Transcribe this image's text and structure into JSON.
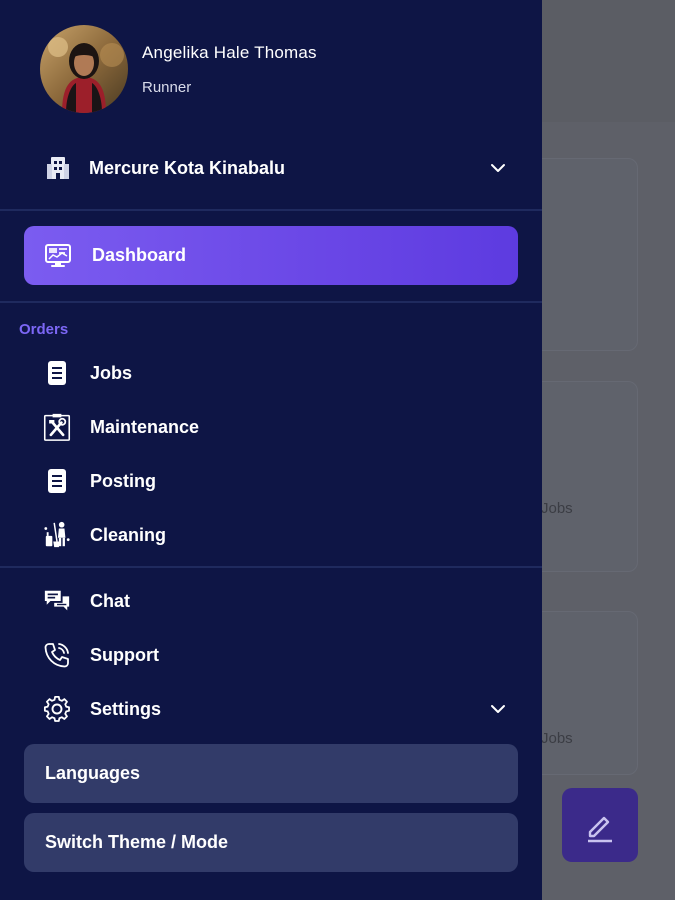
{
  "profile": {
    "name": "Angelika Hale Thomas",
    "role": "Runner"
  },
  "hotel": {
    "name": "Mercure Kota Kinabalu"
  },
  "dashboard": {
    "label": "Dashboard"
  },
  "orders_section": {
    "label": "Orders",
    "items": [
      {
        "label": "Jobs",
        "icon": "document-icon"
      },
      {
        "label": "Maintenance",
        "icon": "tools-icon"
      },
      {
        "label": "Posting",
        "icon": "document-icon"
      },
      {
        "label": "Cleaning",
        "icon": "cleaning-icon"
      }
    ]
  },
  "general_section": {
    "items": [
      {
        "label": "Chat",
        "icon": "chat-icon"
      },
      {
        "label": "Support",
        "icon": "phone-icon"
      },
      {
        "label": "Settings",
        "icon": "gear-icon"
      }
    ]
  },
  "settings_sub": {
    "languages": "Languages",
    "theme": "Switch Theme / Mode"
  },
  "background": {
    "card_texts": [
      "Jobs",
      "Jobs"
    ]
  },
  "colors": {
    "drawer_bg": "#0e1545",
    "accent": "#6a47e6",
    "section_label": "#7c67f5",
    "sub_button_bg": "#323b69"
  }
}
